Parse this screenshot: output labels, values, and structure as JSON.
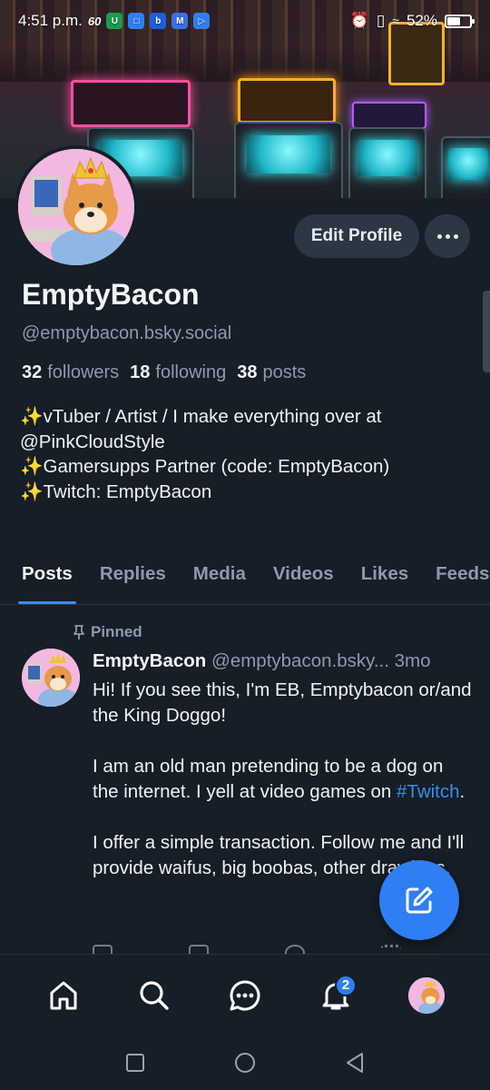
{
  "status_bar": {
    "time": "4:51 p.m.",
    "network_speed": "60",
    "apps": [
      "uber-eats-icon",
      "messages-icon",
      "bluesky-icon",
      "mail-icon",
      "play-icon"
    ],
    "battery": "52%",
    "battery_level": 0.52
  },
  "profile": {
    "display_name": "EmptyBacon",
    "handle": "@emptybacon.bsky.social",
    "edit_label": "Edit Profile",
    "stats": {
      "followers_count": "32",
      "followers_label": "followers",
      "following_count": "18",
      "following_label": "following",
      "posts_count": "38",
      "posts_label": "posts"
    },
    "bio_lines": [
      "✨vTuber / Artist /  I make everything over at",
      "@PinkCloudStyle",
      "✨Gamersupps Partner (code: EmptyBacon)",
      "✨Twitch: EmptyBacon"
    ]
  },
  "tabs": [
    {
      "label": "Posts",
      "active": true
    },
    {
      "label": "Replies",
      "active": false
    },
    {
      "label": "Media",
      "active": false
    },
    {
      "label": "Videos",
      "active": false
    },
    {
      "label": "Likes",
      "active": false
    },
    {
      "label": "Feeds",
      "active": false
    }
  ],
  "pinned_post": {
    "pinned_label": "Pinned",
    "author_name": "EmptyBacon",
    "author_handle": "@emptybacon.bsky...",
    "time": "3mo",
    "paragraph_1": "Hi! If you see this, I'm EB, Emptybacon or/and the King Doggo!",
    "paragraph_2_before": "I am an old man pretending to be a dog on the internet. I yell at video games on ",
    "paragraph_2_tag": "#Twitch",
    "paragraph_2_after": ".",
    "paragraph_3": "I offer a simple transaction. Follow me and I'll provide waifus, big boobas, other drawings."
  },
  "bottom_nav": {
    "items": [
      "home-icon",
      "search-icon",
      "chat-icon",
      "notifications-icon",
      "profile-avatar"
    ],
    "notifications_badge": "2"
  },
  "colors": {
    "background": "#161e27",
    "accent": "#2f7ef3",
    "link": "#3b8cf0",
    "muted_text": "#8d9bab"
  }
}
